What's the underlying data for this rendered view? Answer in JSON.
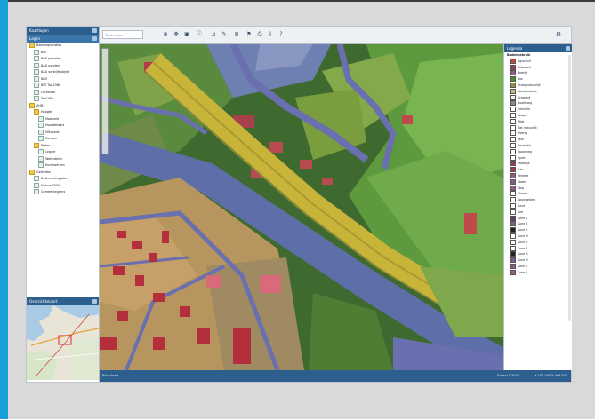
{
  "app": {
    "left_panel": {
      "title": "Kaartlagen",
      "sub_title": "Lagen",
      "tree": [
        {
          "label": "Basisregistraties",
          "folder": true,
          "indent": 0
        },
        {
          "label": "BGT",
          "folder": false,
          "indent": 1
        },
        {
          "label": "BRK percelen",
          "folder": false,
          "indent": 1
        },
        {
          "label": "BAG panden",
          "folder": false,
          "indent": 1
        },
        {
          "label": "BAG verblijfsobject",
          "folder": false,
          "indent": 1
        },
        {
          "label": "BRO",
          "folder": false,
          "indent": 1
        },
        {
          "label": "BRT Top10NL",
          "folder": false,
          "indent": 1
        },
        {
          "label": "Luchtfoto",
          "folder": false,
          "indent": 1
        },
        {
          "label": "Top10NL",
          "folder": false,
          "indent": 1
        },
        {
          "label": "AHN",
          "folder": true,
          "indent": 0
        },
        {
          "label": "Hoogte",
          "folder": true,
          "indent": 1
        },
        {
          "label": "Maaiveld",
          "folder": false,
          "indent": 2
        },
        {
          "label": "Hoogtekaart",
          "folder": false,
          "indent": 2
        },
        {
          "label": "Hillshade",
          "folder": false,
          "indent": 2
        },
        {
          "label": "Contour",
          "folder": false,
          "indent": 2
        },
        {
          "label": "Water",
          "folder": true,
          "indent": 1
        },
        {
          "label": "Legger",
          "folder": false,
          "indent": 2
        },
        {
          "label": "Waterdelen",
          "folder": false,
          "indent": 2
        },
        {
          "label": "Kunstwerken",
          "folder": false,
          "indent": 2
        },
        {
          "label": "Gebieden",
          "folder": true,
          "indent": 0
        },
        {
          "label": "Bestemmingsplan",
          "folder": false,
          "indent": 1
        },
        {
          "label": "Natura 2000",
          "folder": false,
          "indent": 1
        },
        {
          "label": "Gemeentegrens",
          "folder": false,
          "indent": 1
        }
      ],
      "overview_title": "Overzichtskaart"
    },
    "toolbar": {
      "search_placeholder": "Zoek adres...",
      "buttons": [
        {
          "name": "zoom-extent-button",
          "glyph": "⊕"
        },
        {
          "name": "pan-button",
          "glyph": "✥"
        },
        {
          "name": "select-button",
          "glyph": "▣"
        },
        {
          "name": "identify-button",
          "glyph": "ⓘ"
        },
        {
          "name": "measure-button",
          "glyph": "⊿"
        },
        {
          "name": "draw-button",
          "glyph": "✎"
        },
        {
          "name": "layers-button",
          "glyph": "≣"
        },
        {
          "name": "bookmark-button",
          "glyph": "⚑"
        },
        {
          "name": "print-button",
          "glyph": "⎙"
        },
        {
          "name": "export-button",
          "glyph": "⇩"
        },
        {
          "name": "help-button",
          "glyph": "?"
        }
      ],
      "settings_glyph": "⚙"
    },
    "legend": {
      "title": "Legenda",
      "group": "Bodemgebruik",
      "items": [
        {
          "label": "Agrarisch",
          "color": "#c4463c"
        },
        {
          "label": "Bebouwd",
          "color": "#a63a56"
        },
        {
          "label": "Bedrijf",
          "color": "#8f5f8a"
        },
        {
          "label": "Bos",
          "color": "#4e8a38"
        },
        {
          "label": "Droog natuurlijk",
          "color": "#9a8d47"
        },
        {
          "label": "Glastuinbouw",
          "color": "#c9b98a"
        },
        {
          "label": "Grasland",
          "color": "#f2f2f2"
        },
        {
          "label": "Hoofdweg",
          "color": "#8a8a8a"
        },
        {
          "label": "Industrie",
          "color": "#ffffff"
        },
        {
          "label": "Kassen",
          "color": "#ffffff"
        },
        {
          "label": "Maïs",
          "color": "#ffffff"
        },
        {
          "label": "Nat natuurlijk",
          "color": "#ffffff"
        },
        {
          "label": "Overig",
          "color": "#ffffff"
        },
        {
          "label": "Park",
          "color": "#ffffff"
        },
        {
          "label": "Recreatie",
          "color": "#ffffff"
        },
        {
          "label": "Spoorweg",
          "color": "#ffffff"
        },
        {
          "label": "Sport",
          "color": "#ffffff"
        },
        {
          "label": "Stedelijk",
          "color": "#9c3a62"
        },
        {
          "label": "Tuin",
          "color": "#a63a56"
        },
        {
          "label": "Verkeer",
          "color": "#8f5f8a"
        },
        {
          "label": "Water",
          "color": "#7a5c8d"
        },
        {
          "label": "Weg",
          "color": "#8f5f8a"
        },
        {
          "label": "Wonen",
          "color": "#ffffff"
        },
        {
          "label": "Woongebied",
          "color": "#ffffff"
        },
        {
          "label": "Zand",
          "color": "#ffffff"
        },
        {
          "label": "Zee",
          "color": "#ffffff"
        },
        {
          "label": "Zone A",
          "color": "#5a3f6a"
        },
        {
          "label": "Zone B",
          "color": "#7a5c8d"
        },
        {
          "label": "Zone C",
          "color": "#222222"
        },
        {
          "label": "Zone D",
          "color": "#ffffff"
        },
        {
          "label": "Zone E",
          "color": "#ffffff"
        },
        {
          "label": "Zone F",
          "color": "#ffffff"
        },
        {
          "label": "Zone G",
          "color": "#222222"
        },
        {
          "label": "Zone H",
          "color": "#7a5c8d"
        },
        {
          "label": "Zone I",
          "color": "#8f5f8a"
        },
        {
          "label": "Zone J",
          "color": "#8f5f8a"
        }
      ]
    },
    "status": {
      "left": "Print kaart",
      "mid": "Schaal 1:5000",
      "right": "X 155 000 Y 463 000"
    }
  }
}
